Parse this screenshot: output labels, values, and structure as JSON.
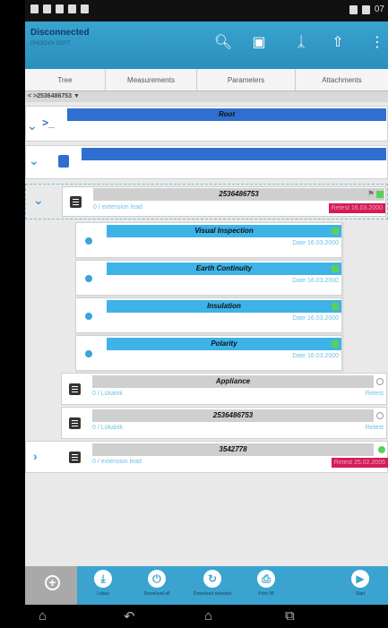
{
  "status": {
    "time": "07"
  },
  "app": {
    "title": "Disconnected",
    "subtitle": "PHOENIX SOFT"
  },
  "tabs": [
    "Tree",
    "Measurements",
    "Parameters",
    "Attachments"
  ],
  "breadcrumb": "< >2536486753 ▼",
  "tree": {
    "root_label": "Root",
    "main": {
      "title": "2536486753",
      "subtitle": "0 / extension lead",
      "retest": "Retest 16.03.2000"
    },
    "tests": [
      {
        "title": "Visual Inspection",
        "date": "Date 16.03.2000"
      },
      {
        "title": "Earth Continuity",
        "date": "Date 16.03.2000"
      },
      {
        "title": "Insulation",
        "date": "Date 16.03.2000"
      },
      {
        "title": "Polarity",
        "date": "Date 16.03.2000"
      }
    ],
    "items": [
      {
        "title": "Appliance",
        "subtitle": "0 / Lükalrik",
        "retest": "Retest"
      },
      {
        "title": "2536486753",
        "subtitle": "0 / Lükalrik",
        "retest": "Retest"
      },
      {
        "title": "3542778",
        "subtitle": "0 / extension lead",
        "retest": "Retest 25.02.2005"
      }
    ]
  },
  "toolbar": [
    {
      "label": "Lobus",
      "icon": "download-icon"
    },
    {
      "label": "Download all",
      "icon": "power-icon"
    },
    {
      "label": "Download selected",
      "icon": "refresh-icon"
    },
    {
      "label": "Print 08",
      "icon": "print-icon"
    },
    {
      "label": "Start",
      "icon": "play-icon"
    }
  ]
}
